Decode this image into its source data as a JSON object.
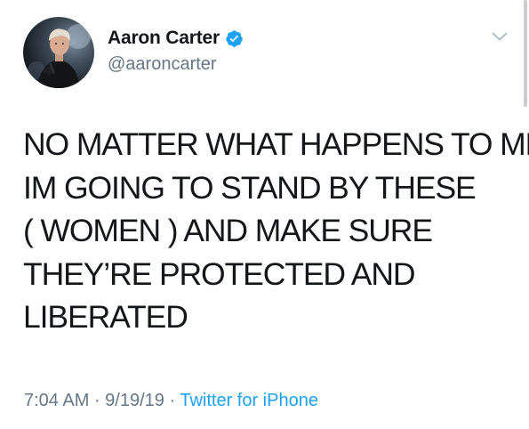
{
  "user": {
    "display_name": "Aaron Carter",
    "handle": "@aaroncarter",
    "verified": true,
    "avatar_icon": "profile-photo"
  },
  "tweet": {
    "lines": [
      "NO MATTER WHAT HAPPENS TO ME",
      "IM GOING TO STAND BY THESE",
      "( WOMEN ) AND MAKE SURE",
      "THEY’RE PROTECTED AND",
      "LIBERATED"
    ]
  },
  "meta": {
    "time": "7:04 AM",
    "date": "9/19/19",
    "separator": " · ",
    "source": "Twitter for iPhone"
  },
  "icons": {
    "verified": "verified-badge-icon",
    "menu": "chevron-down-icon"
  },
  "colors": {
    "text": "#14171a",
    "secondary": "#657786",
    "accent": "#1da1f2"
  }
}
